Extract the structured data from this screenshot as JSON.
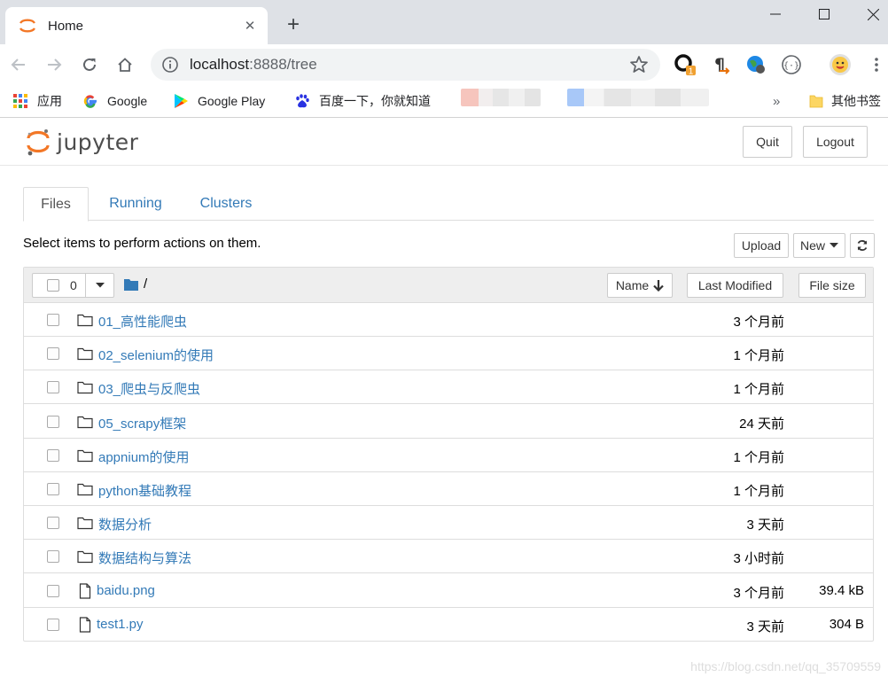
{
  "browser": {
    "tab_title": "Home",
    "url_host": "localhost",
    "url_rest": ":8888/tree",
    "bookmarks": {
      "apps": "应用",
      "google": "Google",
      "google_play": "Google Play",
      "baidu": "百度一下，你就知道",
      "more": "»",
      "other": "其他书签"
    },
    "extension_badge": "1"
  },
  "jupyter": {
    "logo_text": "jupyter",
    "quit_label": "Quit",
    "logout_label": "Logout",
    "tabs": [
      {
        "label": "Files"
      },
      {
        "label": "Running"
      },
      {
        "label": "Clusters"
      }
    ],
    "instructions": "Select items to perform actions on them.",
    "upload_label": "Upload",
    "new_label": "New",
    "selected_count": "0",
    "breadcrumb": "/",
    "columns": {
      "name": "Name",
      "last_modified": "Last Modified",
      "file_size": "File size"
    },
    "rows": [
      {
        "name": "01_高性能爬虫",
        "type": "folder",
        "modified": "3 个月前",
        "size": ""
      },
      {
        "name": "02_selenium的使用",
        "type": "folder",
        "modified": "1 个月前",
        "size": ""
      },
      {
        "name": "03_爬虫与反爬虫",
        "type": "folder",
        "modified": "1 个月前",
        "size": ""
      },
      {
        "name": "05_scrapy框架",
        "type": "folder",
        "modified": "24 天前",
        "size": ""
      },
      {
        "name": "appnium的使用",
        "type": "folder",
        "modified": "1 个月前",
        "size": ""
      },
      {
        "name": "python基础教程",
        "type": "folder",
        "modified": "1 个月前",
        "size": ""
      },
      {
        "name": "数据分析",
        "type": "folder",
        "modified": "3 天前",
        "size": ""
      },
      {
        "name": "数据结构与算法",
        "type": "folder",
        "modified": "3 小时前",
        "size": ""
      },
      {
        "name": "baidu.png",
        "type": "file",
        "modified": "3 个月前",
        "size": "39.4 kB"
      },
      {
        "name": "test1.py",
        "type": "file",
        "modified": "3 天前",
        "size": "304 B"
      }
    ]
  },
  "watermark": "https://blog.csdn.net/qq_35709559",
  "colors": {
    "link": "#337ab7",
    "jupyter_orange": "#f37726",
    "tabstrip": "#dee1e6"
  }
}
